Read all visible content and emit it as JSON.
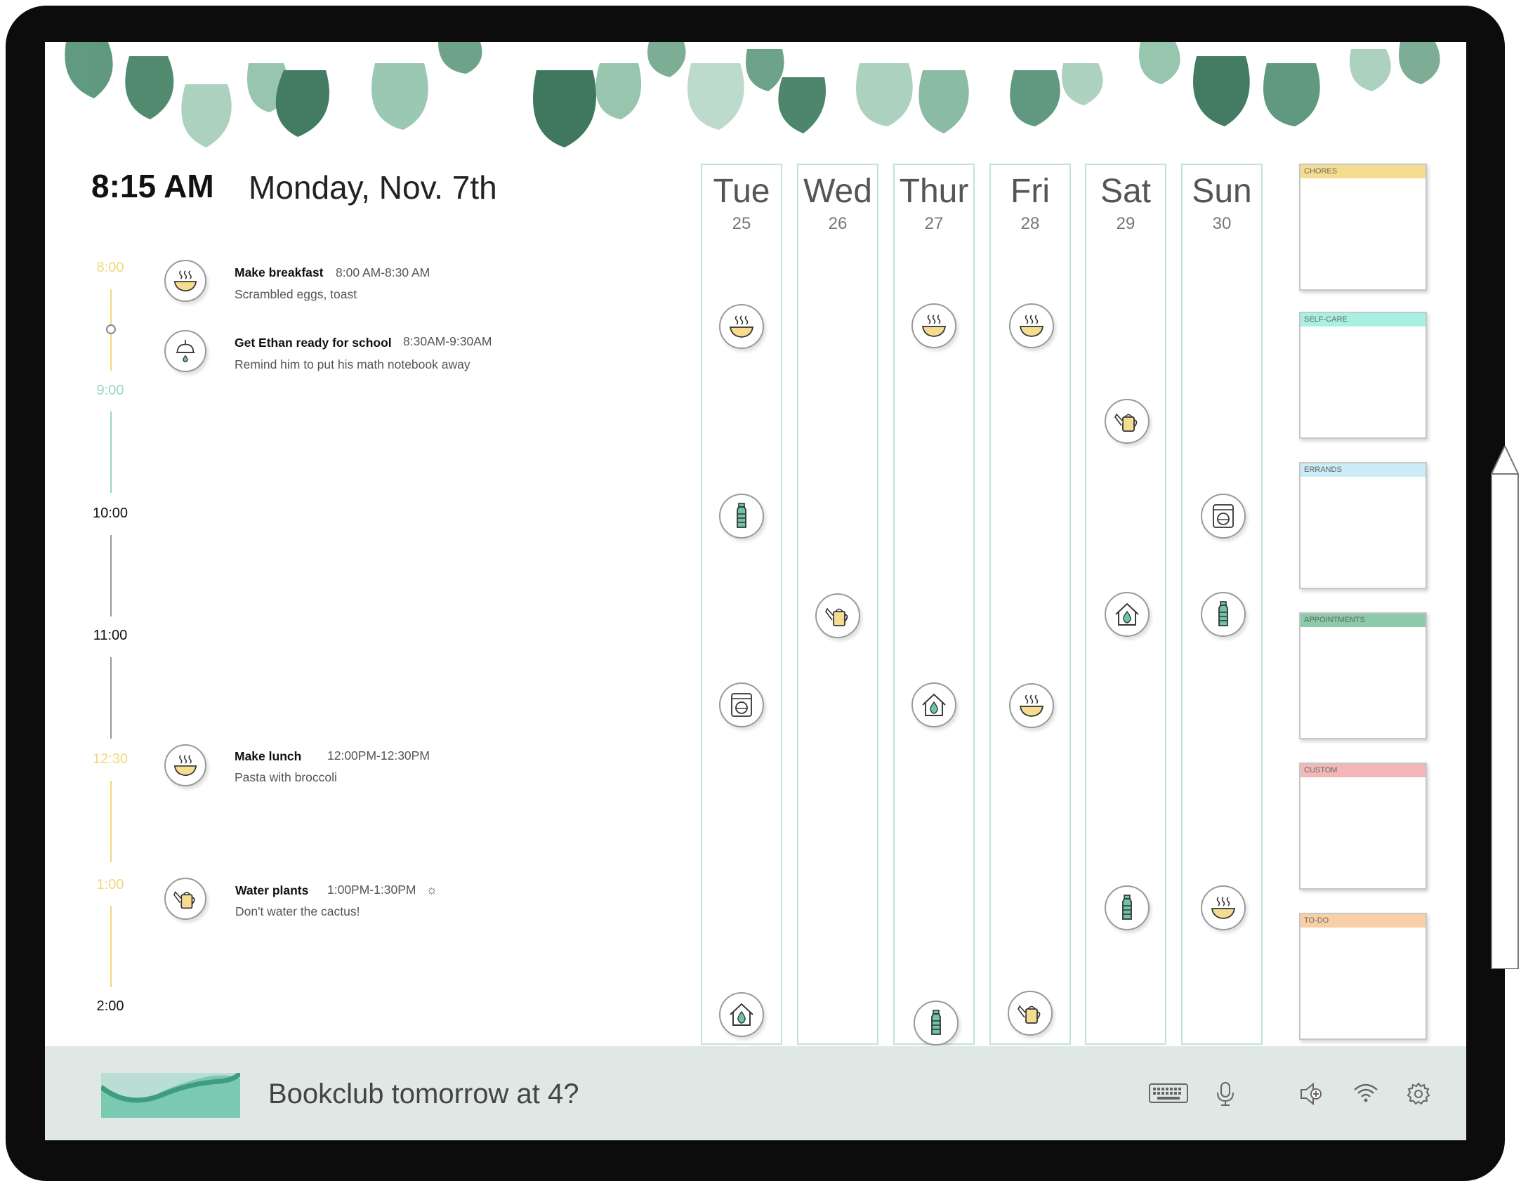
{
  "header": {
    "clock": "8:15 AM",
    "date": "Monday, Nov. 7th"
  },
  "timeline": [
    {
      "label": "8:00",
      "color": "#f3d77d"
    },
    {
      "label": "9:00",
      "color": "#9cd4c7"
    },
    {
      "label": "10:00",
      "color": "#111111"
    },
    {
      "label": "11:00",
      "color": "#111111"
    },
    {
      "label": "12:30",
      "color": "#f3d77d"
    },
    {
      "label": "1:00",
      "color": "#f3d77d"
    },
    {
      "label": "2:00",
      "color": "#111111"
    }
  ],
  "events": [
    {
      "title": "Make breakfast",
      "time": "8:00 AM-8:30 AM",
      "note": "Scrambled eggs, toast",
      "icon": "bowl-icon"
    },
    {
      "title": "Get Ethan ready for school",
      "time": "8:30AM-9:30AM",
      "note": "Remind him to put his math notebook away",
      "icon": "shower-icon"
    },
    {
      "title": "Make lunch",
      "time": "12:00PM-12:30PM",
      "note": "Pasta with broccoli",
      "icon": "bowl-icon"
    },
    {
      "title": "Water plants",
      "time": "1:00PM-1:30PM",
      "time_extra": "☼",
      "note": "Don't water the cactus!",
      "icon": "watering-can-icon"
    }
  ],
  "week": [
    {
      "name": "Tue",
      "date": "25",
      "icons": [
        "bowl-icon",
        "bottle-icon",
        "washer-icon",
        "house-drop-icon"
      ]
    },
    {
      "name": "Wed",
      "date": "26",
      "icons": [
        "watering-can-icon"
      ]
    },
    {
      "name": "Thur",
      "date": "27",
      "icons": [
        "bowl-icon",
        "house-drop-icon",
        "bottle-icon"
      ]
    },
    {
      "name": "Fri",
      "date": "28",
      "icons": [
        "bowl-icon",
        "bowl-icon",
        "watering-can-icon"
      ]
    },
    {
      "name": "Sat",
      "date": "29",
      "icons": [
        "watering-can-icon",
        "house-drop-icon",
        "bottle-icon"
      ]
    },
    {
      "name": "Sun",
      "date": "30",
      "icons": [
        "washer-icon",
        "bottle-icon",
        "bowl-icon"
      ]
    }
  ],
  "categories": [
    {
      "label": "CHORES",
      "color": "#f6dc8f"
    },
    {
      "label": "SELF-CARE",
      "color": "#a8f0e4"
    },
    {
      "label": "ERRANDS",
      "color": "#c9ecf6"
    },
    {
      "label": "APPOINTMENTS",
      "color": "#8ccaa9"
    },
    {
      "label": "CUSTOM",
      "color": "#f2b8b8"
    },
    {
      "label": "TO-DO",
      "color": "#f8cfa6"
    }
  ],
  "bottom": {
    "prompt": "Bookclub tomorrow at 4?",
    "icons": [
      "keyboard-icon",
      "microphone-icon",
      "speaker-icon",
      "wifi-icon",
      "settings-icon"
    ]
  },
  "colors": {
    "accent_mint": "#9cd4c7",
    "accent_yellow": "#f3d77d",
    "bar": "#e0e8e6"
  }
}
